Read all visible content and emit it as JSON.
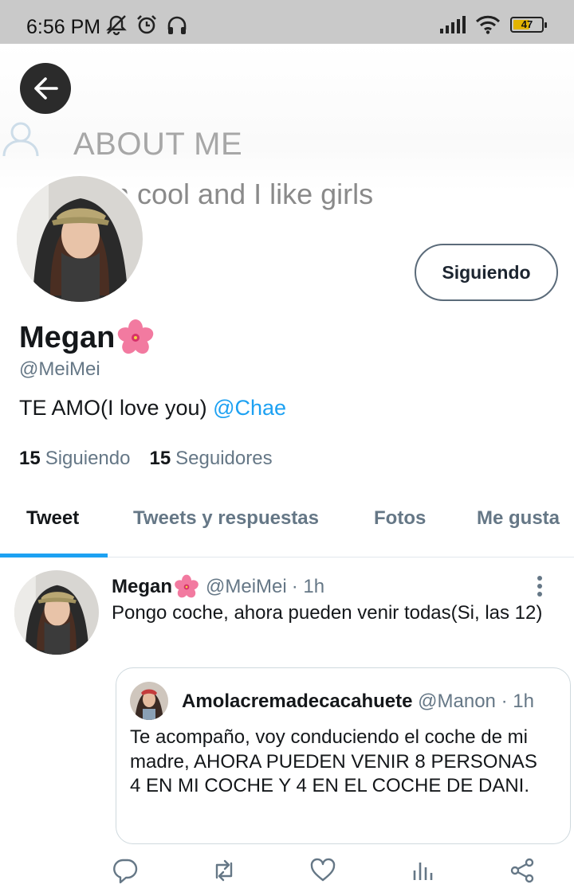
{
  "status_bar": {
    "time": "6:56 PM",
    "battery_level": "47",
    "icons": [
      "mute-icon",
      "alarm-icon",
      "headphones-icon",
      "signal-icon",
      "wifi-icon",
      "battery-icon"
    ]
  },
  "banner": {
    "heading": "ABOUT ME",
    "text": "I am cool and I like girls"
  },
  "profile": {
    "follow_button": "Siguiendo",
    "name": "Megan",
    "handle": "@MeiMei",
    "bio_text": "TE AMO(I love you)",
    "bio_mention": "@Chae",
    "following_count": "15",
    "following_label": "Siguiendo",
    "followers_count": "15",
    "followers_label": "Seguidores"
  },
  "tabs": [
    {
      "label": "Tweet",
      "active": true
    },
    {
      "label": "Tweets y respuestas",
      "active": false
    },
    {
      "label": "Fotos",
      "active": false
    },
    {
      "label": "Me gusta",
      "active": false
    }
  ],
  "tweet": {
    "name": "Megan",
    "handle": "@MeiMei",
    "time": "· 1h",
    "text": "Pongo coche, ahora pueden venir todas(Si, las 12)",
    "quote": {
      "name": "Amolacremadecacahuete",
      "handle": "@Manon",
      "time": "· 1h",
      "text": "Te acompaño, voy conduciendo el coche de mi madre, AHORA PUEDEN VENIR 8 PERSONAS 4 EN MI COCHE Y 4 EN EL COCHE DE DANI."
    }
  },
  "colors": {
    "accent": "#1da1f2",
    "secondary_text": "#657786",
    "primary_text": "#14171a",
    "status_bar_bg": "#c9c9c9"
  }
}
